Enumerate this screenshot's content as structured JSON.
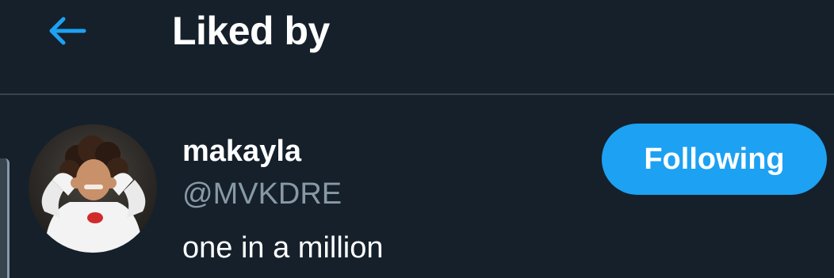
{
  "header": {
    "back_icon": "arrow-left-icon",
    "title": "Liked by"
  },
  "user": {
    "display_name": "makayla",
    "handle": "@MVKDRE",
    "bio": "one in a million",
    "follow_label": "Following",
    "avatar_icon": "user-avatar"
  },
  "colors": {
    "background": "#15202b",
    "accent": "#1da1f2",
    "secondary_text": "#8899a6",
    "divider": "#38444d"
  }
}
